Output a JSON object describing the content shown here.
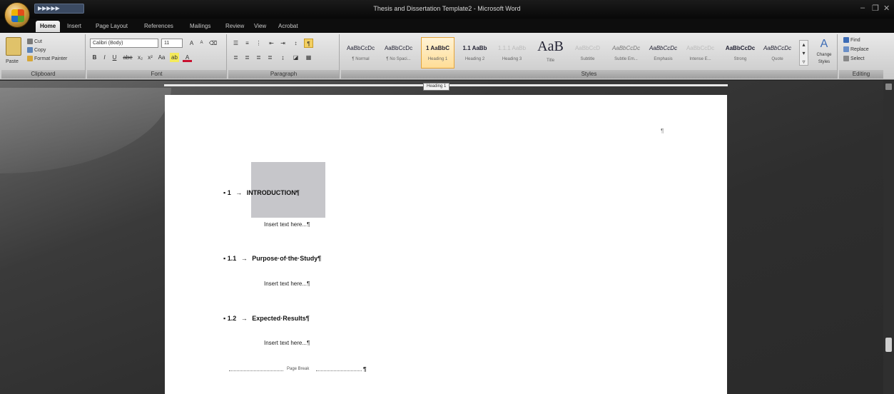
{
  "window": {
    "title": "Thesis and Dissertation Template2 - Microsoft Word",
    "quick_access": "▶▶▶▶▶",
    "controls": {
      "minimize": "–",
      "restore": "❐",
      "close": "✕"
    }
  },
  "tabs": [
    {
      "label": "Home",
      "active": true
    },
    {
      "label": "Insert"
    },
    {
      "label": "Page Layout"
    },
    {
      "label": "References"
    },
    {
      "label": "Mailings"
    },
    {
      "label": "Review"
    },
    {
      "label": "View"
    },
    {
      "label": "Acrobat"
    }
  ],
  "ribbon": {
    "clipboard": {
      "paste": "Paste",
      "cut": "Cut",
      "copy": "Copy",
      "format_painter": "Format Painter",
      "label": "Clipboard"
    },
    "font": {
      "font_name": "Calibri (Body)",
      "font_size": "11",
      "label": "Font",
      "bold": "B",
      "italic": "I",
      "underline": "U",
      "strike": "abe",
      "sub": "x₂",
      "sup": "x²",
      "change_case": "Aa",
      "grow": "A",
      "shrink": "A"
    },
    "paragraph": {
      "label": "Paragraph"
    },
    "styles": {
      "label": "Styles",
      "items": [
        {
          "preview": "AaBbCcDc",
          "name": "¶ Normal"
        },
        {
          "preview": "AaBbCcDc",
          "name": "¶ No Spaci..."
        },
        {
          "preview": "1 AaBbC",
          "name": "Heading 1",
          "selected": true
        },
        {
          "preview": "1.1 AaBb",
          "name": "Heading 2"
        },
        {
          "preview": "1.1.1 AaBb",
          "name": "Heading 3"
        },
        {
          "preview": "AaB",
          "name": "Title",
          "big": true
        },
        {
          "preview": "AaBbCcD",
          "name": "Subtitle"
        },
        {
          "preview": "AaBbCcDc",
          "name": "Subtle Em..."
        },
        {
          "preview": "AaBbCcDc",
          "name": "Emphasis"
        },
        {
          "preview": "AaBbCcDc",
          "name": "Intense E..."
        },
        {
          "preview": "AaBbCcDc",
          "name": "Strong"
        },
        {
          "preview": "AaBbCcDc",
          "name": "Quote"
        }
      ],
      "change_styles": "Change Styles"
    },
    "editing": {
      "find": "Find",
      "replace": "Replace",
      "select": "Select",
      "label": "Editing"
    }
  },
  "ruler_tip": "Heading 1",
  "document": {
    "corner_mark": "¶",
    "headings": [
      {
        "number": "1",
        "title": "INTRODUCTION¶",
        "body": "Insert text here...¶"
      },
      {
        "number": "1.1",
        "title": "Purpose·of·the·Study¶",
        "body": "Insert text here...¶"
      },
      {
        "number": "1.2",
        "title": "Expected·Results¶",
        "body": "Insert text here...¶"
      }
    ],
    "bullet": "▪",
    "tab_arrow": "→",
    "page_break": {
      "label": "Page Break",
      "pilcrow": "¶"
    }
  }
}
